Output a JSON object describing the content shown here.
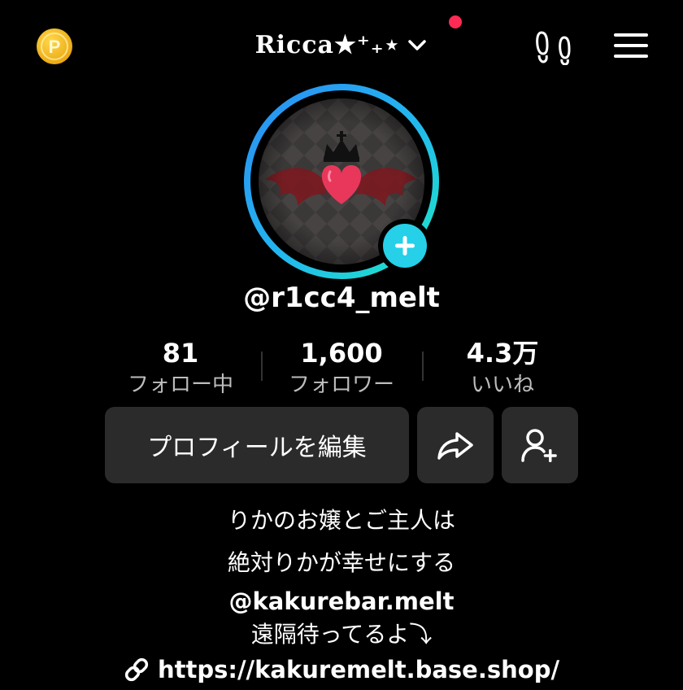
{
  "header": {
    "display_name": "Riccaꕤ",
    "display_name_text": "Ricca★⁺₊⋆",
    "icons": {
      "coin": "coin-icon",
      "chevron": "chevron-down-icon",
      "notification": "notification-dot",
      "footprints": "footprints-icon",
      "menu": "hamburger-menu-icon"
    }
  },
  "profile": {
    "username": "@r1cc4_melt"
  },
  "stats": [
    {
      "value": "81",
      "label": "フォロー中"
    },
    {
      "value": "1,600",
      "label": "フォロワー"
    },
    {
      "value": "4.3万",
      "label": "いいね"
    }
  ],
  "buttons": {
    "edit_profile": "プロフィールを編集"
  },
  "bio": {
    "line1": "りかのお嬢とご主人は",
    "line2": "絶対りかが幸せにする",
    "mention": "@kakurebar.melt",
    "line3": "遠隔待ってるよ⤵︎"
  },
  "link": {
    "url": "https://kakuremelt.base.shop/"
  },
  "colors": {
    "background": "#000000",
    "ring_start": "#2aa7f5",
    "ring_end": "#1fe3c8",
    "accent_cyan": "#25d0e8",
    "notification": "#ff2b54",
    "coin": "#f7b928",
    "button_bg": "#2b2b2b"
  }
}
